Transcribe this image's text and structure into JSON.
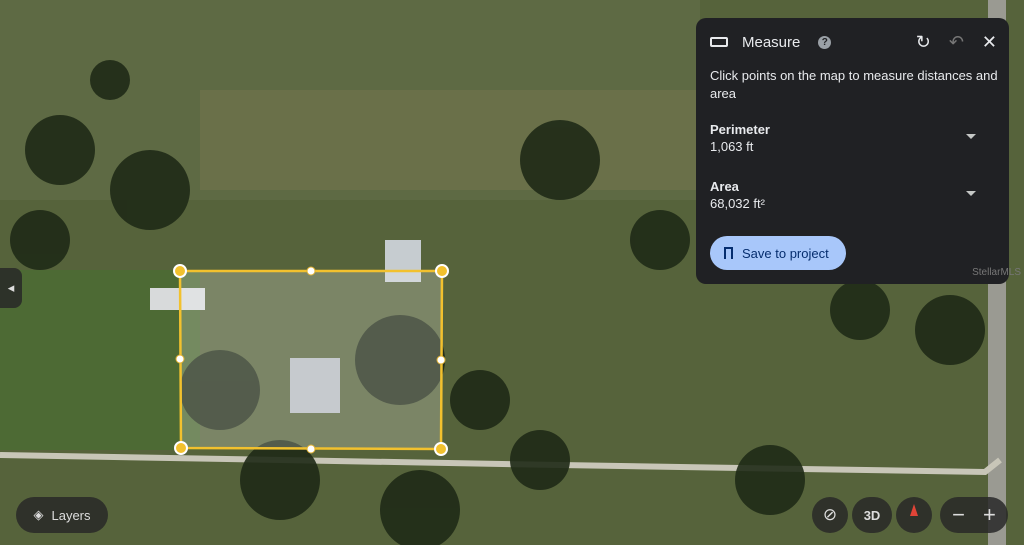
{
  "measure": {
    "title": "Measure",
    "help_icon": "?",
    "description": "Click points on the map to measure distances and area",
    "perimeter_label": "Perimeter",
    "perimeter_value": "1,063 ft",
    "area_label": "Area",
    "area_value": "68,032 ft²",
    "save_label": "Save to project",
    "watermark": "StellarMLS"
  },
  "controls": {
    "layers_label": "Layers",
    "threed_label": "3D",
    "zoom_out": "−",
    "zoom_in": "+"
  },
  "colors": {
    "polygon": "#f2c12e",
    "panel": "#202124",
    "save_button": "#a8c7fa"
  }
}
